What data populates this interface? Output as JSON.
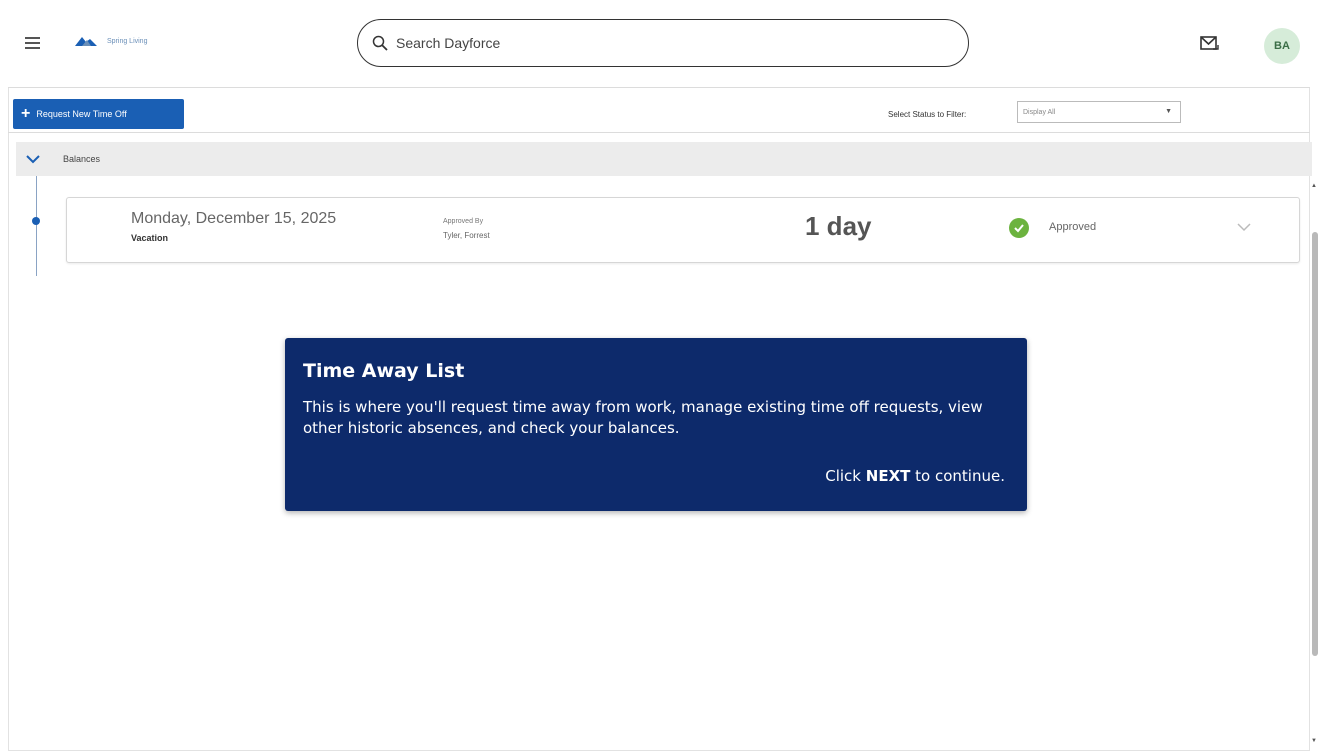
{
  "header": {
    "menu_icon": "hamburger-menu-icon",
    "logo_text": "Spring Living",
    "search_placeholder": "Search Dayforce",
    "mail_icon": "mail-icon",
    "avatar_initials": "BA"
  },
  "toolbar": {
    "request_button_label": "Request New Time Off",
    "filter_label": "Select Status to Filter:",
    "filter_value": "Display All"
  },
  "balances": {
    "label": "Balances"
  },
  "time_off_entries": [
    {
      "date": "Monday, December 15, 2025",
      "type": "Vacation",
      "approved_by_label": "Approved By",
      "approver": "Tyler, Forrest",
      "duration": "1 day",
      "status": "Approved",
      "status_color": "#6cb33f"
    }
  ],
  "tour": {
    "title": "Time Away List",
    "body": "This is where you'll request time away from work, manage existing time off requests, view other historic absences, and check your balances.",
    "next_prefix": "Click",
    "next_keyword": "NEXT",
    "next_suffix": "to continue."
  },
  "colors": {
    "primary": "#1a5fb4",
    "tour_background": "#0d2a6b",
    "approved": "#6cb33f",
    "balances_bar": "#ececec"
  }
}
